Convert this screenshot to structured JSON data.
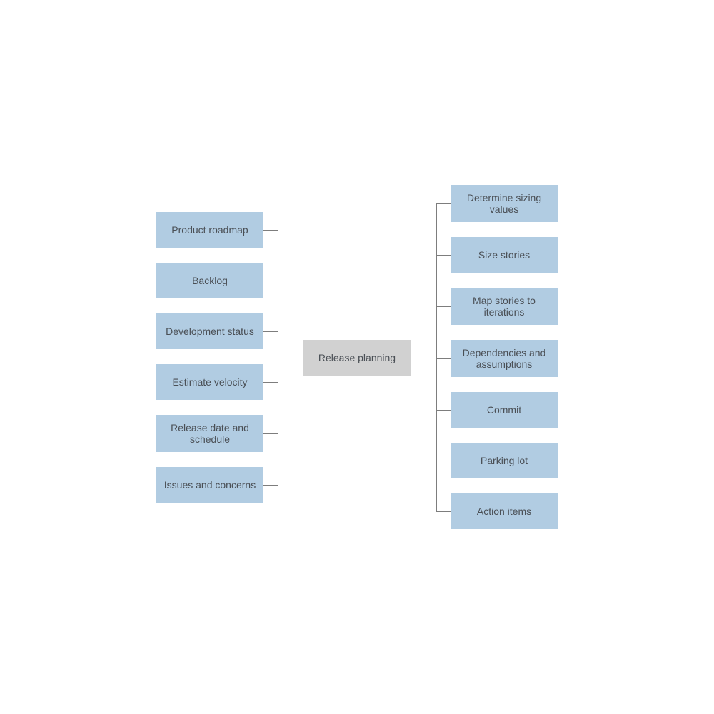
{
  "diagram": {
    "center": {
      "label": "Release planning",
      "color": "#d1d1d1"
    },
    "left_nodes": [
      {
        "label": "Product roadmap"
      },
      {
        "label": "Backlog"
      },
      {
        "label": "Development status"
      },
      {
        "label": "Estimate velocity"
      },
      {
        "label": "Release date and schedule"
      },
      {
        "label": "Issues and concerns"
      }
    ],
    "right_nodes": [
      {
        "label": "Determine sizing values"
      },
      {
        "label": "Size stories"
      },
      {
        "label": "Map stories to iterations"
      },
      {
        "label": "Dependencies and assumptions"
      },
      {
        "label": "Commit"
      },
      {
        "label": "Parking lot"
      },
      {
        "label": "Action items"
      }
    ],
    "colors": {
      "leaf": "#b1cce2",
      "center": "#d1d1d1",
      "connector": "#7d7d7d",
      "text": "#4a4f55"
    }
  }
}
